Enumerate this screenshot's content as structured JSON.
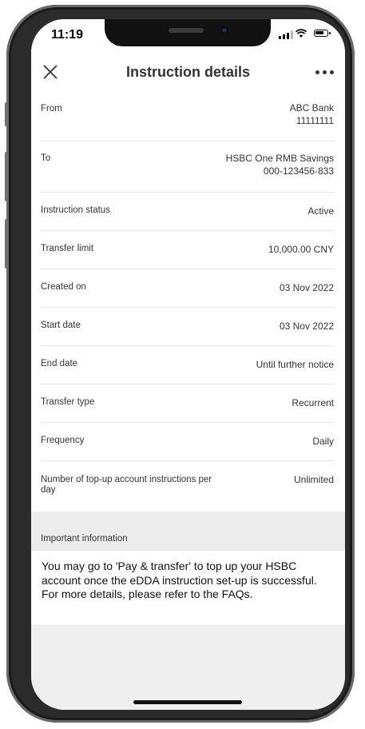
{
  "status_bar": {
    "time": "11:19"
  },
  "header": {
    "title": "Instruction details"
  },
  "details": [
    {
      "label": "From",
      "values": [
        "ABC Bank",
        "11111111"
      ]
    },
    {
      "label": "To",
      "values": [
        "HSBC  One RMB Savings",
        "000-123456-833"
      ]
    },
    {
      "label": "Instruction status",
      "values": [
        "Active"
      ]
    },
    {
      "label": "Transfer limit",
      "values": [
        "10,000.00 CNY"
      ]
    },
    {
      "label": "Created on",
      "values": [
        "03 Nov 2022"
      ]
    },
    {
      "label": "Start date",
      "values": [
        "03 Nov 2022"
      ]
    },
    {
      "label": "End date",
      "values": [
        "Until further notice"
      ]
    },
    {
      "label": "Transfer type",
      "values": [
        "Recurrent"
      ]
    },
    {
      "label": "Frequency",
      "values": [
        "Daily"
      ]
    },
    {
      "label": "Number of top-up account instructions per day",
      "values": [
        "Unlimited"
      ]
    }
  ],
  "important": {
    "heading": "Important information",
    "text": "You may go to 'Pay & transfer' to top up your HSBC account once the eDDA instruction set-up is successful. For more details, please refer to the FAQs."
  },
  "colors": {
    "text": "#333333",
    "divider": "#e4e4e4",
    "section_bg": "#ececec"
  }
}
